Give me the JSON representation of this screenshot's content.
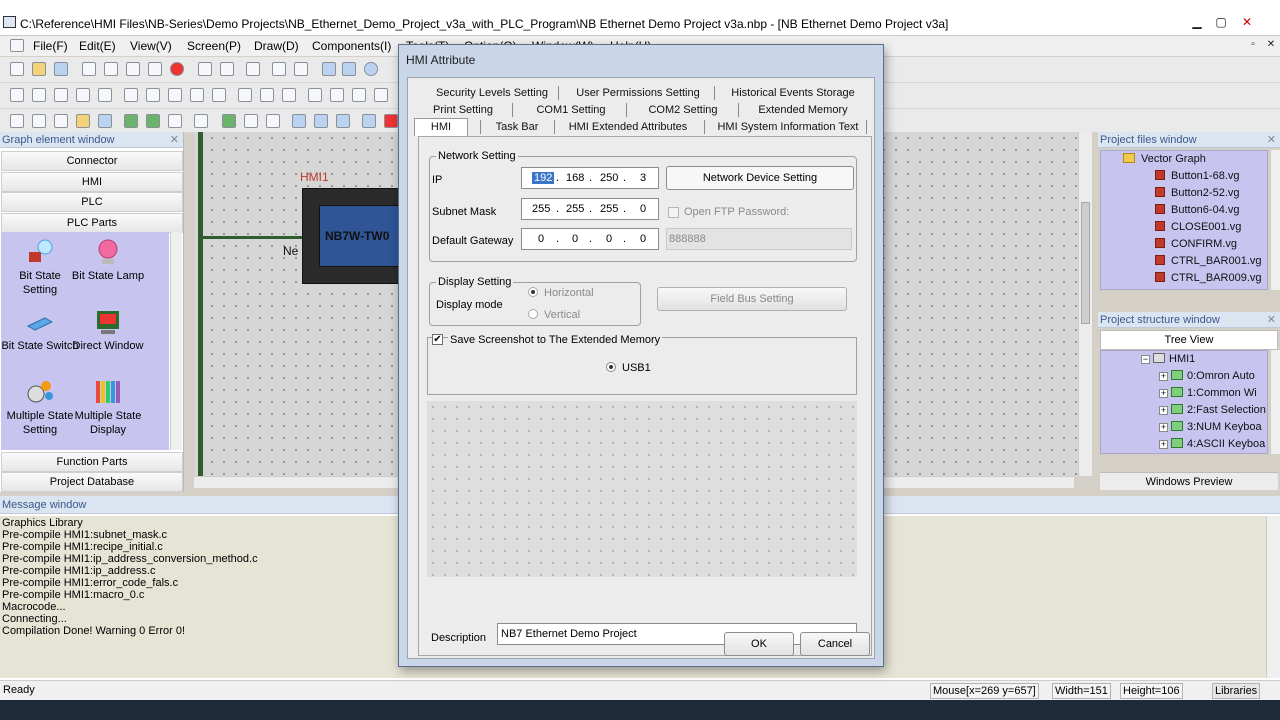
{
  "window": {
    "title": "C:\\Reference\\HMI Files\\NB-Series\\Demo Projects\\NB_Ethernet_Demo_Project_v3a_with_PLC_Program\\NB Ethernet Demo Project v3a.nbp - [NB Ethernet Demo Project v3a]"
  },
  "menu": [
    "File(F)",
    "Edit(E)",
    "View(V)",
    "Screen(P)",
    "Draw(D)",
    "Components(I)",
    "Tools(T)",
    "Option(O)",
    "Window(W)",
    "Help(H)"
  ],
  "graph_element_window": {
    "title": "Graph element window",
    "categories_top": [
      "Connector",
      "HMI",
      "PLC",
      "PLC Parts"
    ],
    "parts": [
      {
        "label": "Bit State Setting",
        "icon": "bit-state-setting-icon"
      },
      {
        "label": "Bit State Lamp",
        "icon": "bit-state-lamp-icon"
      },
      {
        "label": "Bit State Switch",
        "icon": "bit-state-switch-icon"
      },
      {
        "label": "Direct Window",
        "icon": "direct-window-icon"
      },
      {
        "label": "Multiple State Setting",
        "icon": "multiple-state-setting-icon"
      },
      {
        "label": "Multiple State Display",
        "icon": "multiple-state-display-icon"
      }
    ],
    "categories_bottom": [
      "Function Parts",
      "Project Database"
    ]
  },
  "canvas": {
    "hmi_label": "HMI1",
    "device_label": "NB7W-TW0",
    "net_label": "Ne"
  },
  "project_files_window": {
    "title": "Project files window",
    "folder": "Vector Graph",
    "files": [
      "Button1-68.vg",
      "Button2-52.vg",
      "Button6-04.vg",
      "CLOSE001.vg",
      "CONFIRM.vg",
      "CTRL_BAR001.vg",
      "CTRL_BAR009.vg"
    ]
  },
  "project_structure_window": {
    "title": "Project structure window",
    "tree_view_label": "Tree View",
    "root": "HMI1",
    "items": [
      "0:Omron Auto",
      "1:Common Wi",
      "2:Fast Selection",
      "3:NUM Keyboa",
      "4:ASCII Keyboa"
    ],
    "footer": "Windows Preview"
  },
  "message_window": {
    "title": "Message window",
    "lines": [
      "Graphics Library",
      "Pre-compile HMI1:subnet_mask.c",
      "Pre-compile HMI1:recipe_initial.c",
      "Pre-compile HMI1:ip_address_conversion_method.c",
      "Pre-compile HMI1:ip_address.c",
      "Pre-compile HMI1:error_code_fals.c",
      "Pre-compile HMI1:macro_0.c",
      "Macrocode...",
      "Connecting...",
      "Compilation Done! Warning 0 Error 0!"
    ]
  },
  "status_bar": {
    "status": "Ready",
    "mouse": "Mouse[x=269  y=657]",
    "width": "Width=151",
    "height": "Height=106",
    "libraries": "Libraries"
  },
  "dialog": {
    "title": "HMI Attribute",
    "tabs_row1": [
      "Security Levels Setting",
      "User Permissions Setting",
      "Historical Events Storage"
    ],
    "tabs_row2": [
      "Print Setting",
      "COM1 Setting",
      "COM2 Setting",
      "Extended Memory"
    ],
    "tabs_row3": [
      "HMI",
      "Task Bar",
      "HMI Extended Attributes",
      "HMI System Information Text"
    ],
    "network": {
      "group_title": "Network Setting",
      "ip_label": "IP",
      "ip": [
        "192",
        "168",
        "250",
        "3"
      ],
      "subnet_label": "Subnet Mask",
      "subnet": [
        "255",
        "255",
        "255",
        "0"
      ],
      "gateway_label": "Default Gateway",
      "gateway": [
        "0",
        "0",
        "0",
        "0"
      ],
      "device_button": "Network Device Setting",
      "open_ftp_label": "Open FTP",
      "password_label": "Password:",
      "password_value": "888888"
    },
    "display": {
      "group_title": "Display Setting",
      "mode_label": "Display mode",
      "horizontal": "Horizontal",
      "vertical": "Vertical",
      "field_bus_button": "Field Bus Setting"
    },
    "screenshot": {
      "label": "Save Screenshot to The Extended Memory",
      "checked": true,
      "usb_label": "USB1"
    },
    "description_label": "Description",
    "description_value": "NB7 Ethernet Demo Project",
    "ok": "OK",
    "cancel": "Cancel"
  }
}
